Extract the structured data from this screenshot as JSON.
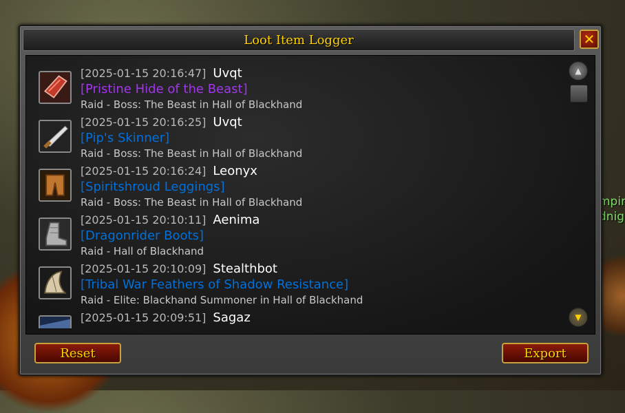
{
  "window": {
    "title": "Loot Item Logger",
    "close_label": "✕"
  },
  "background": {
    "side_text": "mpir\ndnig"
  },
  "entries": [
    {
      "timestamp": "[2025-01-15 20:16:47]",
      "player": "Uvqt",
      "item": "[Pristine Hide of the Beast]",
      "quality": "epic",
      "source": "Raid - Boss: The Beast in Hall of Blackhand",
      "icon": "hide-icon"
    },
    {
      "timestamp": "[2025-01-15 20:16:25]",
      "player": "Uvqt",
      "item": "[Pip's Skinner]",
      "quality": "rare",
      "source": "Raid - Boss: The Beast in Hall of Blackhand",
      "icon": "dagger-icon"
    },
    {
      "timestamp": "[2025-01-15 20:16:24]",
      "player": "Leonyx",
      "item": "[Spiritshroud Leggings]",
      "quality": "rare",
      "source": "Raid - Boss: The Beast in Hall of Blackhand",
      "icon": "leggings-icon"
    },
    {
      "timestamp": "[2025-01-15 20:10:11]",
      "player": "Aenima",
      "item": "[Dragonrider Boots]",
      "quality": "rare",
      "source": "Raid - Hall of Blackhand",
      "icon": "boots-icon"
    },
    {
      "timestamp": "[2025-01-15 20:10:09]",
      "player": "Stealthbot",
      "item": "[Tribal War Feathers of Shadow Resistance]",
      "quality": "rare",
      "source": "Raid - Elite: Blackhand Summoner in Hall of Blackhand",
      "icon": "feathers-icon"
    },
    {
      "timestamp": "[2025-01-15 20:09:51]",
      "player": "Sagaz",
      "item": "",
      "quality": "rare",
      "source": "",
      "icon": "unknown-item-icon"
    }
  ],
  "buttons": {
    "reset": "Reset",
    "export": "Export"
  },
  "colors": {
    "epic": "#a335ee",
    "rare": "#0070dd",
    "title": "#ffd200"
  }
}
